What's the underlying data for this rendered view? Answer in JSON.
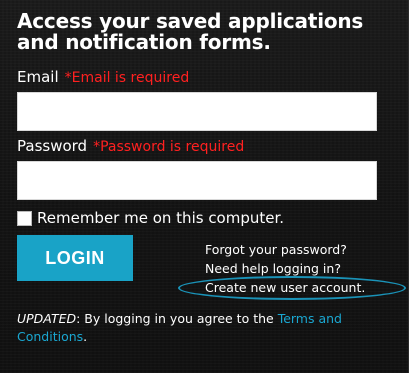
{
  "heading": "Access your saved applications and notification forms.",
  "email": {
    "label": "Email",
    "error": "*Email is required",
    "value": ""
  },
  "password": {
    "label": "Password",
    "error": "*Password is required",
    "value": ""
  },
  "remember": {
    "label": "Remember me on this computer.",
    "checked": false
  },
  "login_button": "LOGIN",
  "links": {
    "forgot_password": "Forgot your password?",
    "help_logging_in": "Need help logging in?",
    "create_account": "Create new user account."
  },
  "footer": {
    "updated_label": "UPDATED",
    "text": ": By logging in you agree to the ",
    "terms_link": "Terms and Conditions",
    "end": "."
  },
  "colors": {
    "accent": "#19a3c7",
    "error": "#ff2020",
    "link": "#1aa7d1",
    "highlight": "#1a93b8"
  }
}
